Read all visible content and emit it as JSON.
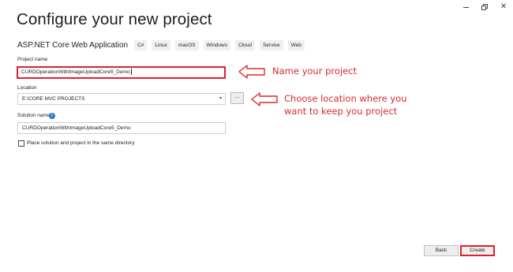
{
  "window": {
    "minimize_icon": "minimize-icon",
    "restore_icon": "restore-icon",
    "close_glyph": "✕"
  },
  "page": {
    "title": "Configure your new project"
  },
  "template": {
    "name": "ASP.NET Core Web Application",
    "tags": [
      "C#",
      "Linux",
      "macOS",
      "Windows",
      "Cloud",
      "Service",
      "Web"
    ]
  },
  "project_name": {
    "label": "Project name",
    "value": "CURDOperationWithImageUploadCore5_Demo"
  },
  "location": {
    "label": "Location",
    "value": "E:\\CORE MVC PROJECTS",
    "browse_label": "..."
  },
  "solution_name": {
    "label": "Solution name",
    "value": "CURDOperationWithImageUploadCore5_Demo",
    "info_glyph": "i"
  },
  "place_same_directory": {
    "label": "Place solution and project in the same directory",
    "checked": false
  },
  "annotations": {
    "name_hint": "Name your project",
    "location_hint_line1": "Choose location where you",
    "location_hint_line2": "want to keep you project",
    "color": "#d92b2b"
  },
  "footer": {
    "back_label": "Back",
    "create_label": "Create"
  }
}
